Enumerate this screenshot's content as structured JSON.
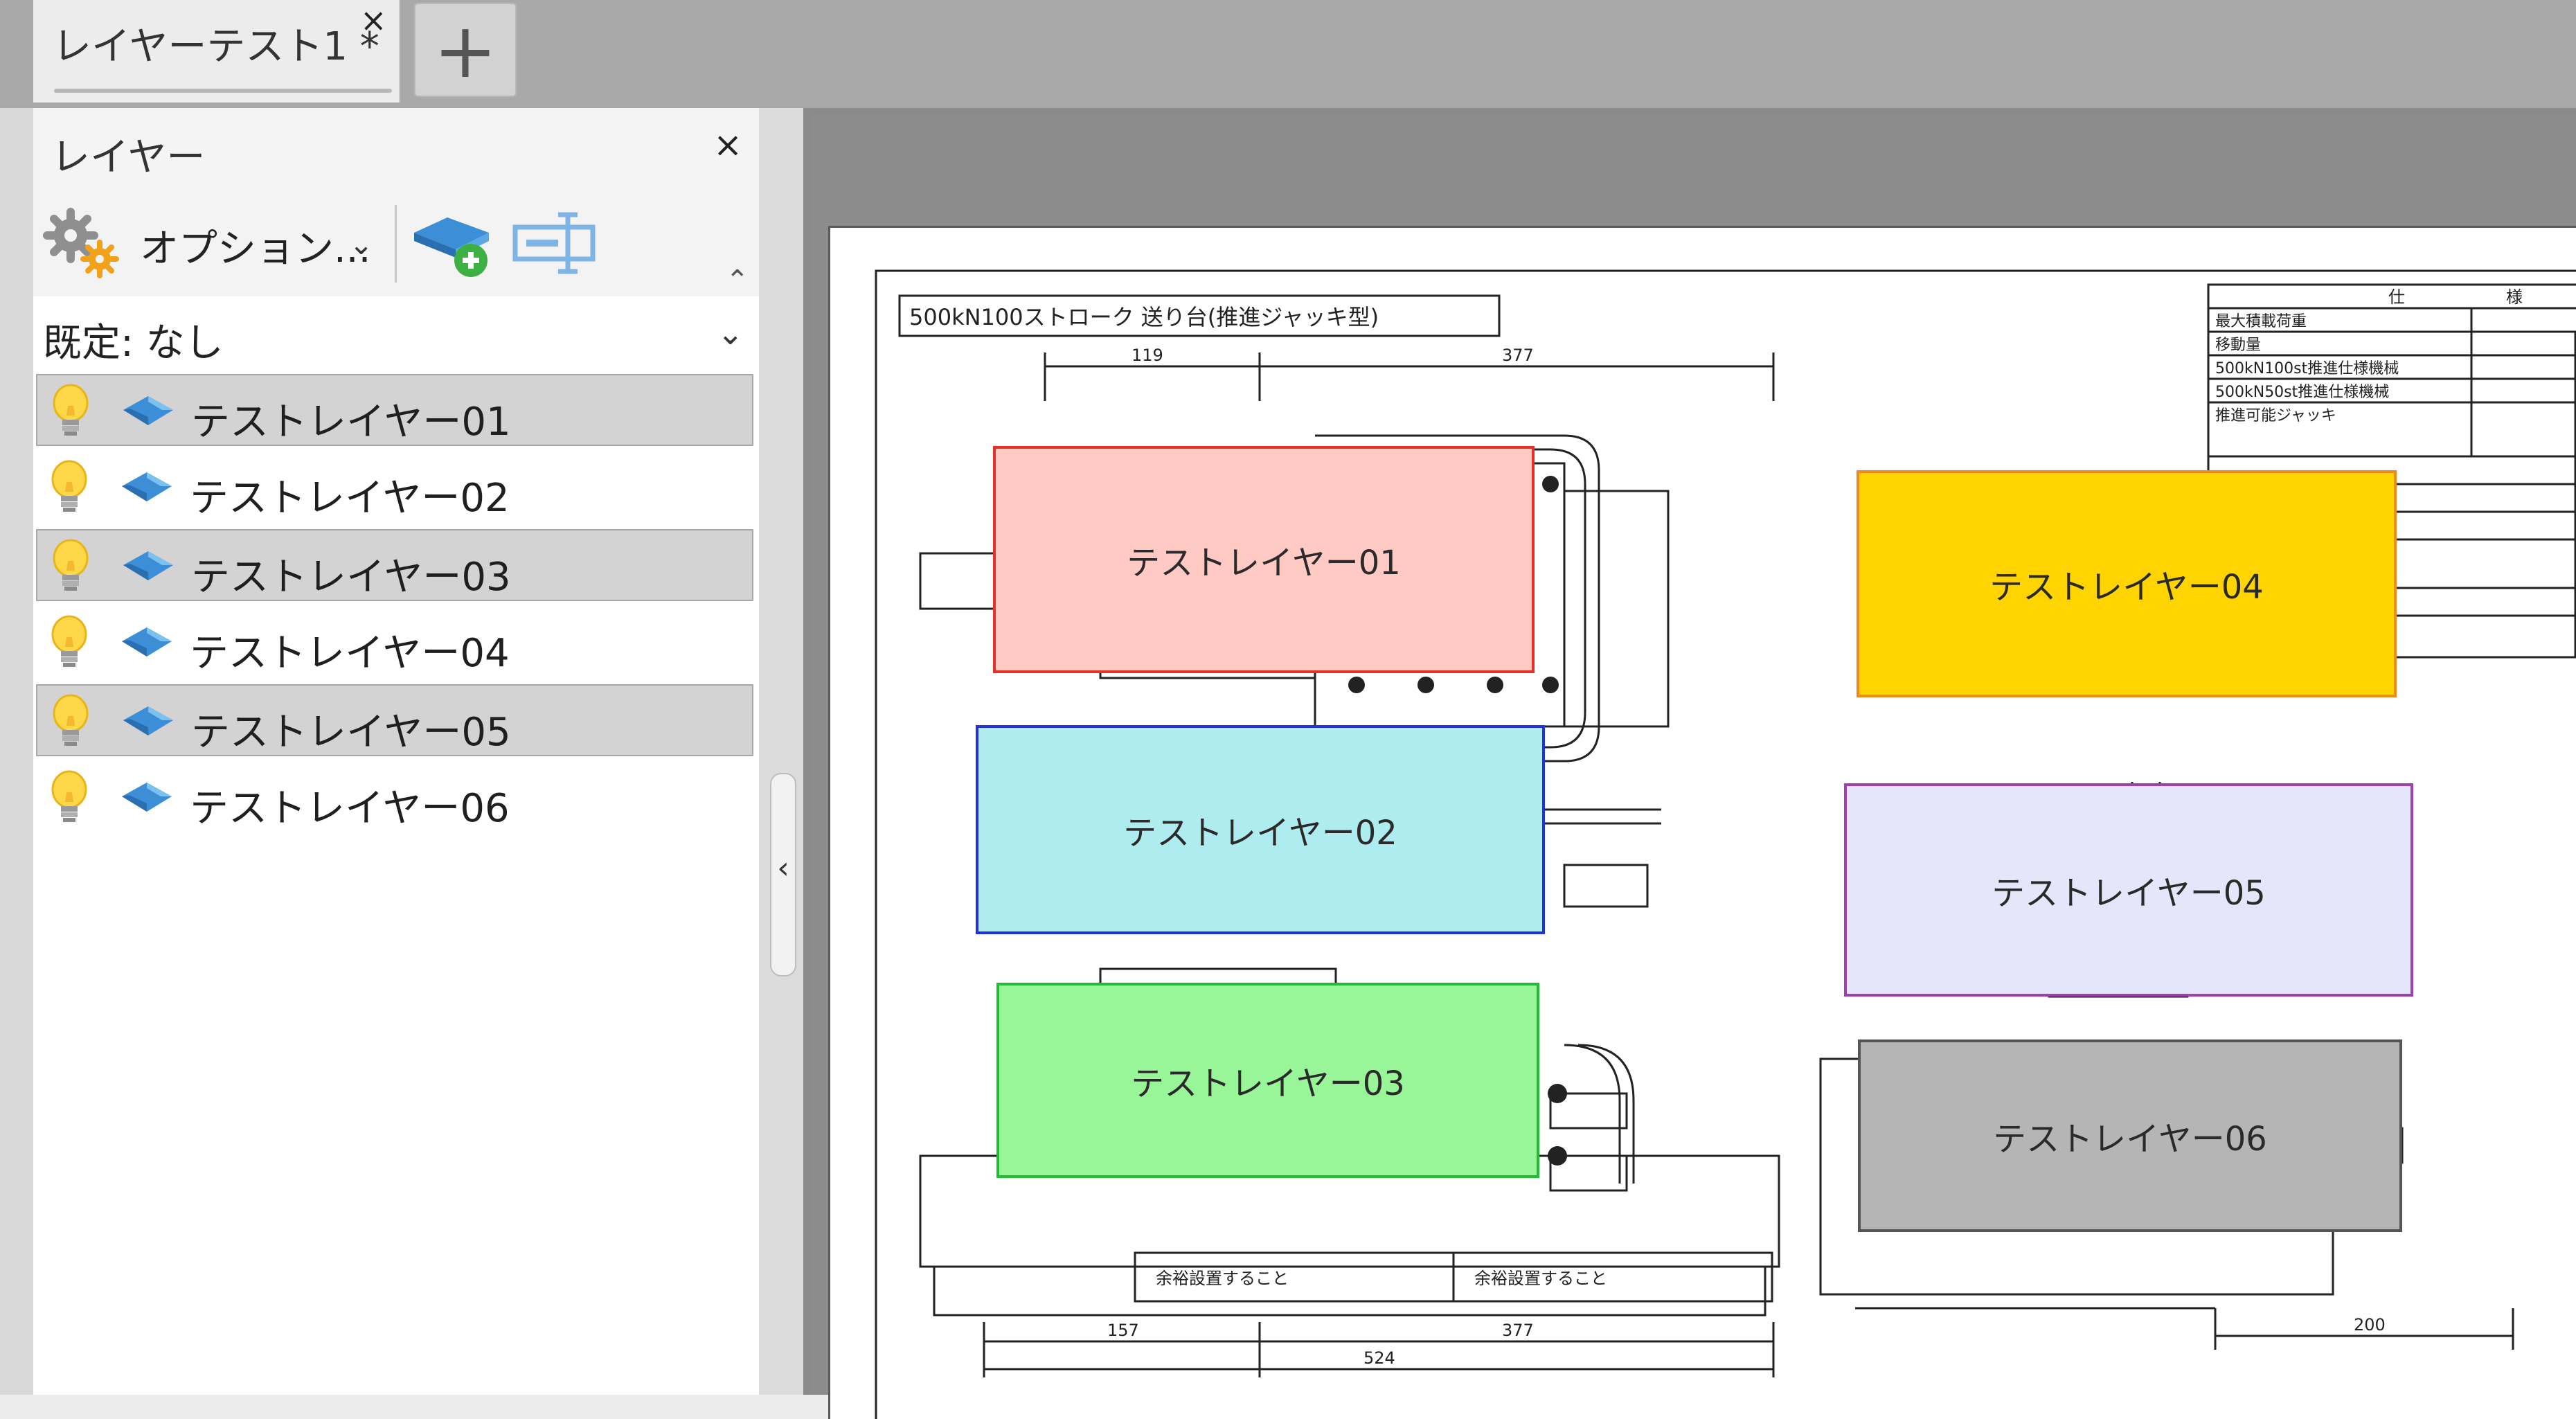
{
  "tabs": {
    "active_label": "レイヤーテスト1 *",
    "close_glyph": "×",
    "new_tab_glyph": "+"
  },
  "panel": {
    "title": "レイヤー",
    "close_glyph": "×",
    "options_label": "オプション...",
    "chevron_glyph": "⌄",
    "collapse_glyph": "⌃",
    "default_label": "既定: なし",
    "icons": [
      "gear-icon",
      "add-layer-icon",
      "rename-layer-icon",
      "lightbulb-icon",
      "layer-icon"
    ]
  },
  "layers": [
    {
      "name": "テストレイヤー01",
      "selected": true
    },
    {
      "name": "テストレイヤー02",
      "selected": false
    },
    {
      "name": "テストレイヤー03",
      "selected": true
    },
    {
      "name": "テストレイヤー04",
      "selected": false
    },
    {
      "name": "テストレイヤー05",
      "selected": true
    },
    {
      "name": "テストレイヤー06",
      "selected": false
    }
  ],
  "splitter": {
    "glyph": "‹"
  },
  "drawing": {
    "title": "500kN100ストローク 送り台(推進ジャッキ型)",
    "dims": [
      "119",
      "377",
      "157",
      "377",
      "524",
      "200"
    ],
    "notes": [
      "余裕設置すること",
      "余裕設置すること"
    ],
    "spec_header": [
      "仕",
      "様"
    ],
    "spec_rows": [
      "最大積載荷重",
      "移動量",
      "500kN100st推進仕様機械",
      "500kN50st推進仕様機械",
      "推進可能ジャッキ"
    ]
  },
  "canvas_layers": [
    {
      "label": "テストレイヤー01",
      "fill": "#ffc9c4",
      "stroke": "#e8302a"
    },
    {
      "label": "テストレイヤー02",
      "fill": "#afecef",
      "stroke": "#2233dd"
    },
    {
      "label": "テストレイヤー03",
      "fill": "#98f598",
      "stroke": "#22bb33"
    },
    {
      "label": "テストレイヤー04",
      "fill": "#ffd400",
      "stroke": "#f08a1a"
    },
    {
      "label": "テストレイヤー05",
      "fill": "#e6e6fa",
      "stroke": "#a040b0"
    },
    {
      "label": "テストレイヤー06",
      "fill": "#b5b5b5",
      "stroke": "#555555"
    }
  ]
}
